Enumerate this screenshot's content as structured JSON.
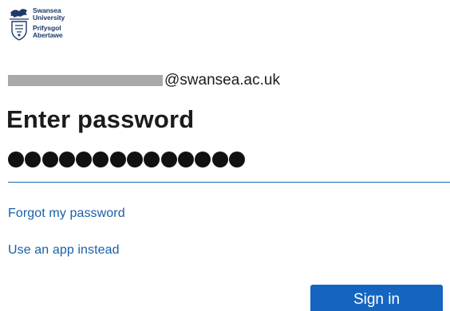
{
  "brand": {
    "logo_icon": "swansea-university-crest-icon",
    "name_lines": [
      "Swansea",
      "University",
      "Prifysgol",
      "Abertawe"
    ]
  },
  "account": {
    "email_domain": "@swansea.ac.uk",
    "username_redacted": true
  },
  "heading": "Enter password",
  "password": {
    "masked_length": 14
  },
  "links": {
    "forgot": "Forgot my password",
    "app_instead": "Use an app instead"
  },
  "actions": {
    "sign_in": "Sign in"
  },
  "colors": {
    "accent": "#1565c0",
    "link": "#1a5fa8",
    "input_underline": "#1a67b5",
    "redaction": "#a9a9a9"
  }
}
